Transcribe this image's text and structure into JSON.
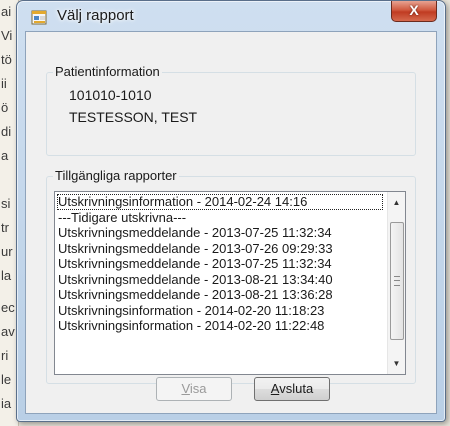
{
  "background": {
    "fragments": [
      "ai",
      "Vi",
      "tö",
      "ii",
      "ö",
      "di",
      "a",
      "si",
      "tr",
      "ur",
      "la",
      "ec",
      "av",
      "ri",
      "le",
      "ia"
    ]
  },
  "window": {
    "title": "Välj rapport",
    "close_label": "X"
  },
  "patient": {
    "legend": "Patientinformation",
    "id": "101010-1010",
    "name": "TESTESSON, TEST"
  },
  "reports": {
    "legend": "Tillgängliga rapporter",
    "items": [
      "Utskrivningsinformation - 2014-02-24 14:16",
      "---Tidigare utskrivna---",
      "Utskrivningsmeddelande - 2013-07-25 11:32:34",
      "Utskrivningsmeddelande - 2013-07-26 09:29:33",
      "Utskrivningsmeddelande - 2013-07-25 11:32:34",
      "Utskrivningsmeddelande - 2013-08-21 13:34:40",
      "Utskrivningsmeddelande - 2013-08-21 13:36:28",
      "Utskrivningsinformation - 2014-02-20 11:18:23",
      "Utskrivningsinformation - 2014-02-20 11:22:48"
    ],
    "selected_index": 0,
    "scroll_up": "▲",
    "scroll_down": "▼"
  },
  "buttons": {
    "visa_mnemonic": "V",
    "visa_rest": "isa",
    "avsluta_mnemonic": "A",
    "avsluta_rest": "vsluta"
  }
}
